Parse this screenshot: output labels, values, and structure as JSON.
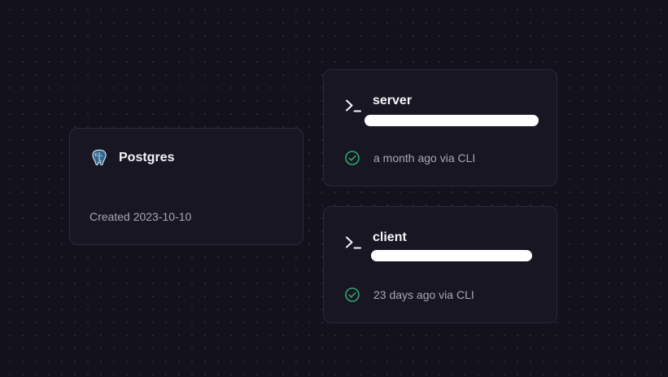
{
  "canvas": {
    "background_color": "#13111c",
    "dot_color": "#2e2b3c"
  },
  "services": [
    {
      "name": "Postgres",
      "icon": "postgres-elephant-icon",
      "meta": "Created 2023-10-10"
    },
    {
      "name": "server",
      "icon": "terminal-icon",
      "status_icon": "check-circle-icon",
      "status": "a month ago via CLI",
      "status_color": "#2faa6a"
    },
    {
      "name": "client",
      "icon": "terminal-icon",
      "status_icon": "check-circle-icon",
      "status": "23 days ago via CLI",
      "status_color": "#2faa6a"
    }
  ]
}
